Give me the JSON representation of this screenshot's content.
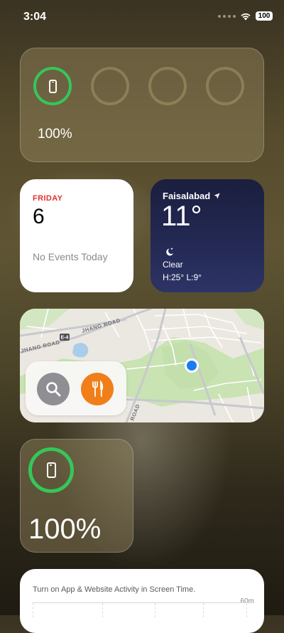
{
  "status_bar": {
    "time": "3:04",
    "battery": "100"
  },
  "batteries_widget": {
    "percent": "100%",
    "level": 1.0
  },
  "calendar": {
    "day": "FRIDAY",
    "date": "6",
    "events": "No Events Today"
  },
  "weather": {
    "city": "Faisalabad",
    "temp": "11°",
    "condition": "Clear",
    "high_low": "H:25° L:9°"
  },
  "map": {
    "roads": {
      "jhang_upper": "JHANG ROAD",
      "jhang_lower": "JHANG ROAD",
      "highway": "E-4",
      "side": "ROAD"
    },
    "buttons": {
      "search": "Search",
      "food": "Food"
    }
  },
  "batteries_small": {
    "percent": "100%",
    "level": 1.0
  },
  "screen_time": {
    "message": "Turn on App & Website Activity in Screen Time.",
    "axis_max": "60m"
  },
  "colors": {
    "accent_green": "#34c759",
    "calendar_red": "#e0322f",
    "food_orange": "#f07f1a",
    "location_blue": "#1a7cf2"
  }
}
